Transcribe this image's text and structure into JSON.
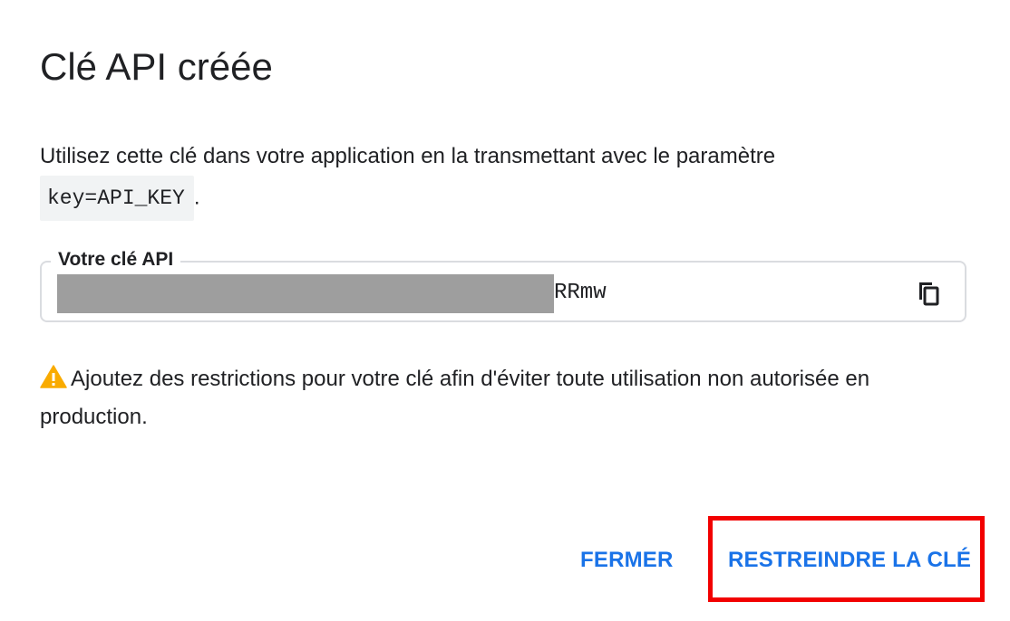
{
  "dialog": {
    "title": "Clé API créée",
    "description_text": "Utilisez cette clé dans votre application en la transmettant avec le paramètre",
    "param_code": "key=API_KEY",
    "param_suffix": ".",
    "key_field": {
      "label": "Votre clé API",
      "visible_suffix": "RRmw",
      "copy_icon": "copy-icon"
    },
    "warning": {
      "icon": "warning-icon",
      "text": "Ajoutez des restrictions pour votre clé afin d'éviter toute utilisation non autorisée en production."
    },
    "actions": {
      "close_label": "FERMER",
      "restrict_label": "RESTREINDRE LA CLÉ"
    }
  },
  "colors": {
    "accent": "#1a73e8",
    "highlight": "#f20000",
    "warning": "#f9ab00",
    "redaction": "#9e9e9e"
  }
}
